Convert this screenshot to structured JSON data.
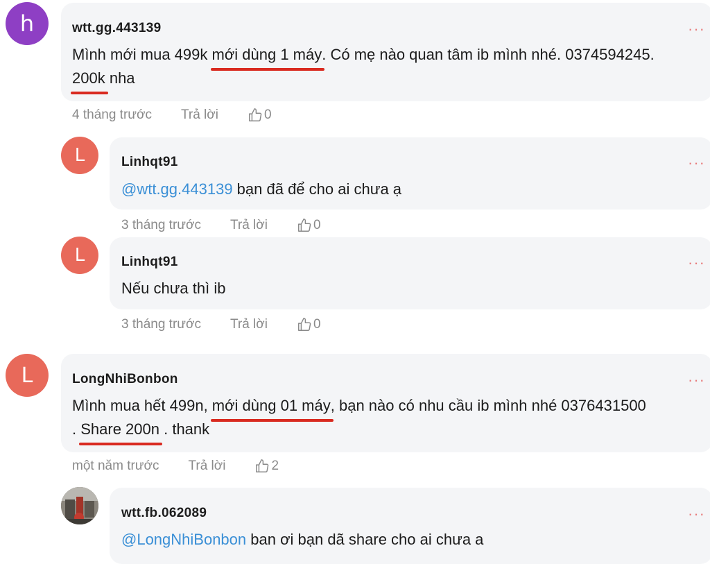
{
  "comments": [
    {
      "avatar_letter": "h",
      "avatar_color": "#8e3fc4",
      "author": "wtt.gg.443139",
      "line1_a": "Mình mới mua 499k ",
      "line1_u": "mới dùng 1 máy",
      "line1_b": ". Có mẹ nào quan tâm ib mình nhé. 0374594245.",
      "line2_u": "200k",
      "line2_b": " nha",
      "time": "4 tháng trước",
      "reply_label": "Trả lời",
      "likes": "0",
      "more": "···"
    },
    {
      "avatar_letter": "L",
      "avatar_color": "#e8695a",
      "author": "Linhqt91",
      "mention": "@wtt.gg.443139",
      "text": " bạn đã để cho ai chưa ạ",
      "time": "3 tháng trước",
      "reply_label": "Trả lời",
      "likes": "0",
      "more": "···"
    },
    {
      "avatar_letter": "L",
      "avatar_color": "#e8695a",
      "author": "Linhqt91",
      "text": "Nếu chưa thì ib",
      "time": "3 tháng trước",
      "reply_label": "Trả lời",
      "likes": "0",
      "more": "···"
    },
    {
      "avatar_letter": "L",
      "avatar_color": "#e8695a",
      "author": "LongNhiBonbon",
      "line1_a": "Mình mua hết 499n, ",
      "line1_u": "mới dùng 01 máy",
      "line1_b": ", bạn nào có nhu cầu ib mình nhé 0376431500",
      "line2_a": ". ",
      "line2_u": "Share 200n",
      "line2_b": " . thank",
      "time": "một năm trước",
      "reply_label": "Trả lời",
      "likes": "2",
      "more": "···"
    },
    {
      "author": "wtt.fb.062089",
      "mention": "@LongNhiBonbon",
      "text": " ban ơi bạn dã share cho ai chưa a",
      "more": "···"
    }
  ]
}
